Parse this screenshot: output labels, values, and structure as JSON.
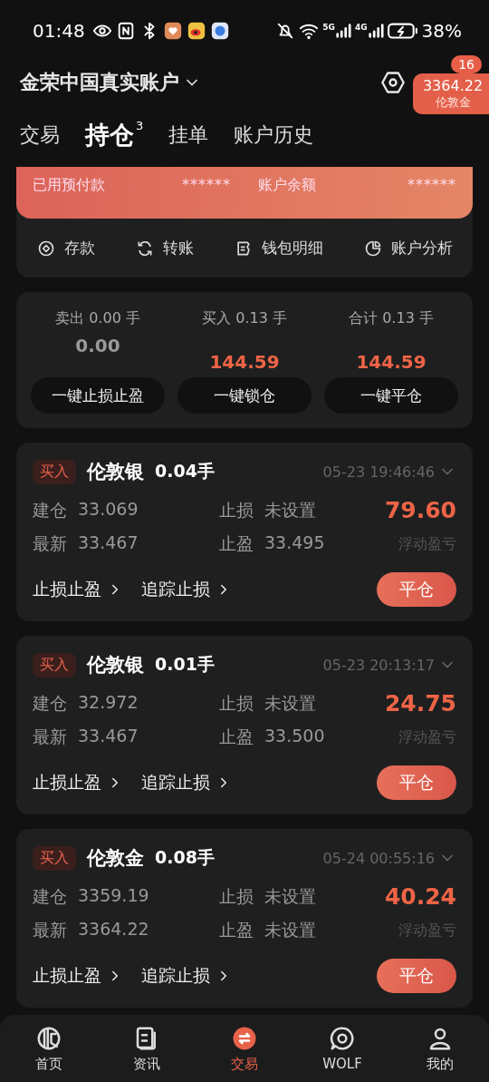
{
  "status_bar": {
    "time": "01:48",
    "net_5g": "5G",
    "net_4g": "4G",
    "battery": "38%"
  },
  "header": {
    "account": "金荣中国真实账户",
    "badge": "16",
    "price_tag": {
      "price": "3364.22",
      "symbol": "伦敦金"
    }
  },
  "tabs": [
    {
      "label": "交易",
      "selected": false
    },
    {
      "label": "持仓",
      "selected": true,
      "count": "3"
    },
    {
      "label": "挂单",
      "selected": false
    },
    {
      "label": "账户历史",
      "selected": false
    }
  ],
  "account_banner": {
    "items": [
      {
        "label": "已用预付款",
        "value": "******"
      },
      {
        "label": "账户余额",
        "value": "******"
      }
    ]
  },
  "actions": [
    {
      "kind": "deposit",
      "label": "存款"
    },
    {
      "kind": "transfer",
      "label": "转账"
    },
    {
      "kind": "wallet",
      "label": "钱包明细"
    },
    {
      "kind": "analysis",
      "label": "账户分析"
    }
  ],
  "summary": {
    "columns": [
      {
        "label": "卖出 0.00 手",
        "value": "0.00",
        "positive": false
      },
      {
        "label": "买入 0.13 手",
        "value": "144.59",
        "positive": true
      },
      {
        "label": "合计 0.13 手",
        "value": "144.59",
        "positive": true
      }
    ],
    "buttons": [
      "一键止损止盈",
      "一键锁仓",
      "一键平仓"
    ]
  },
  "positions": [
    {
      "side": "买入",
      "symbol": "伦敦银",
      "lots": "0.04手",
      "time": "05-23 19:46:46",
      "open_label": "建仓",
      "open": "33.069",
      "latest_label": "最新",
      "latest": "33.467",
      "sl_label": "止损",
      "sl": "未设置",
      "tp_label": "止盈",
      "tp": "33.495",
      "pnl": "79.60",
      "pnl_label": "浮动盈亏",
      "links": [
        "止损止盈",
        "追踪止损"
      ],
      "close": "平仓"
    },
    {
      "side": "买入",
      "symbol": "伦敦银",
      "lots": "0.01手",
      "time": "05-23 20:13:17",
      "open_label": "建仓",
      "open": "32.972",
      "latest_label": "最新",
      "latest": "33.467",
      "sl_label": "止损",
      "sl": "未设置",
      "tp_label": "止盈",
      "tp": "33.500",
      "pnl": "24.75",
      "pnl_label": "浮动盈亏",
      "links": [
        "止损止盈",
        "追踪止损"
      ],
      "close": "平仓"
    },
    {
      "side": "买入",
      "symbol": "伦敦金",
      "lots": "0.08手",
      "time": "05-24 00:55:16",
      "open_label": "建仓",
      "open": "3359.19",
      "latest_label": "最新",
      "latest": "3364.22",
      "sl_label": "止损",
      "sl": "未设置",
      "tp_label": "止盈",
      "tp": "未设置",
      "pnl": "40.24",
      "pnl_label": "浮动盈亏",
      "links": [
        "止损止盈",
        "追踪止损"
      ],
      "close": "平仓"
    }
  ],
  "bottom_nav": [
    {
      "kind": "home",
      "label": "首页",
      "selected": false
    },
    {
      "kind": "news",
      "label": "资讯",
      "selected": false
    },
    {
      "kind": "trade",
      "label": "交易",
      "selected": true
    },
    {
      "kind": "wolf",
      "label": "WOLF",
      "selected": false
    },
    {
      "kind": "me",
      "label": "我的",
      "selected": false
    }
  ]
}
